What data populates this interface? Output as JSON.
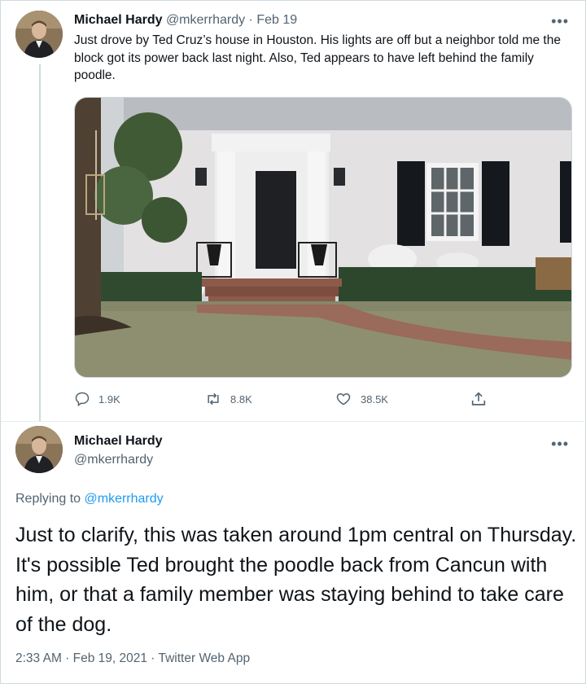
{
  "tweet": {
    "author_name": "Michael Hardy",
    "handle": "@mkerrhardy",
    "separator": " · ",
    "date": "Feb 19",
    "more_label": "•••",
    "text": "Just drove by Ted Cruz’s house in Houston. His lights are off but a neighbor told me the block got its power back last night. Also, Ted appears to have left behind the family poodle.",
    "actions": {
      "reply_count": "1.9K",
      "retweet_count": "8.8K",
      "like_count": "38.5K"
    }
  },
  "reply_tweet": {
    "author_name": "Michael Hardy",
    "handle": "@mkerrhardy",
    "more_label": "•••",
    "replying_to_prefix": "Replying to ",
    "replying_to_handle": "@mkerrhardy",
    "text": "Just to clarify, this was taken around 1pm central on Thursday. It's possible Ted brought the poodle back from Cancun with him, or that a family member was staying behind to take care of the dog.",
    "timestamp": "2:33 AM · Feb 19, 2021 · Twitter Web App"
  },
  "colors": {
    "link_blue": "#1d9bf0",
    "muted_gray": "#536471",
    "text_dark": "#0f1419"
  },
  "icons": {
    "reply": "speech-bubble-icon",
    "retweet": "retweet-arrows-icon",
    "like": "heart-outline-icon",
    "share": "share-upload-icon",
    "more": "three-dots-icon"
  }
}
